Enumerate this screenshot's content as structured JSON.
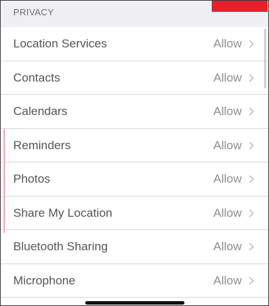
{
  "section": {
    "header": "PRIVACY"
  },
  "colors": {
    "accent_mark": "#e8202a",
    "header_bg": "#efeff4"
  },
  "privacy_items": [
    {
      "label": "Location Services",
      "value": "Allow",
      "icon": "chevron-right-icon"
    },
    {
      "label": "Contacts",
      "value": "Allow",
      "icon": "chevron-right-icon"
    },
    {
      "label": "Calendars",
      "value": "Allow",
      "icon": "chevron-right-icon"
    },
    {
      "label": "Reminders",
      "value": "Allow",
      "icon": "chevron-right-icon"
    },
    {
      "label": "Photos",
      "value": "Allow",
      "icon": "chevron-right-icon"
    },
    {
      "label": "Share My Location",
      "value": "Allow",
      "icon": "chevron-right-icon"
    },
    {
      "label": "Bluetooth Sharing",
      "value": "Allow",
      "icon": "chevron-right-icon"
    },
    {
      "label": "Microphone",
      "value": "Allow",
      "icon": "chevron-right-icon"
    }
  ]
}
